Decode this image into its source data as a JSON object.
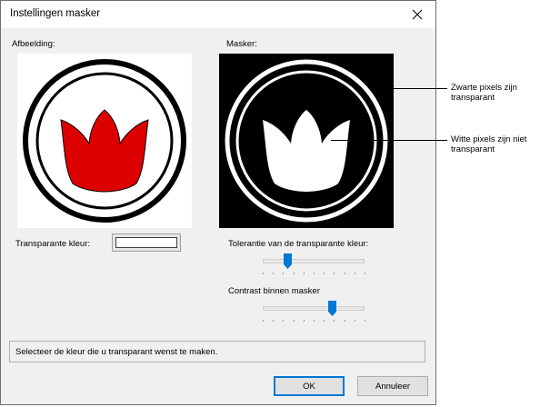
{
  "window": {
    "title": "Instellingen masker"
  },
  "labels": {
    "image": "Afbeelding:",
    "mask": "Masker:",
    "transparent_color": "Transparante kleur:",
    "tolerance": "Tolerantie van de transparante kleur:",
    "contrast": "Contrast binnen masker"
  },
  "colors": {
    "dialog_bg": "#f0f0f0",
    "tulip": "#dd0000",
    "accent": "#0078d7",
    "transparent_color_value": "#ffffff"
  },
  "sliders": {
    "tolerance": {
      "value": 0.24
    },
    "contrast": {
      "value": 0.68
    }
  },
  "status": {
    "text": "Selecteer de kleur die u transparant wenst te maken."
  },
  "buttons": {
    "ok": "OK",
    "cancel": "Annuleer"
  },
  "callouts": {
    "black_pixels": [
      "Zwarte pixels zijn",
      "transparant"
    ],
    "white_pixels": [
      "Witte pixels zijn niet",
      "transparant"
    ]
  },
  "icons": {
    "close": "close-icon"
  }
}
